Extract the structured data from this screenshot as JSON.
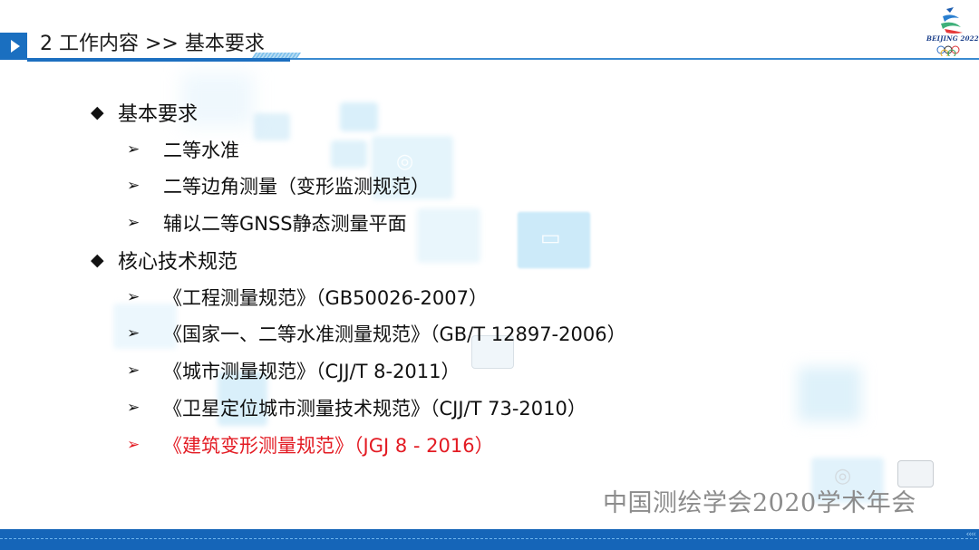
{
  "header": {
    "title": "2 工作内容 >> 基本要求",
    "play_icon": "play-triangle-icon",
    "accent_color": "#1a6fc0"
  },
  "logo": {
    "text": "BEIJING 2022",
    "icon": "olympic-rings-icon"
  },
  "sections": [
    {
      "bullet": "◆",
      "label": "基本要求",
      "items": [
        {
          "bullet": "➢",
          "label": "二等水准"
        },
        {
          "bullet": "➢",
          "label": "二等边角测量（变形监测规范）"
        },
        {
          "bullet": "➢",
          "label": "辅以二等GNSS静态测量平面"
        }
      ]
    },
    {
      "bullet": "◆",
      "label": "核心技术规范",
      "items": [
        {
          "bullet": "➢",
          "label": "《工程测量规范》（GB50026-2007）"
        },
        {
          "bullet": "➢",
          "label": "《国家一、二等水准测量规范》（GB/T 12897-2006）"
        },
        {
          "bullet": "➢",
          "label": "《城市测量规范》（CJJ/T 8-2011）"
        },
        {
          "bullet": "➢",
          "label": "《卫星定位城市测量技术规范》（CJJ/T 73-2010）"
        },
        {
          "bullet": "➢",
          "label": "《建筑变形测量规范》（JGJ 8 - 2016）",
          "highlight": true,
          "color": "#e31b23"
        }
      ]
    }
  ],
  "footer": {
    "text": "中国测绘学会2020学术年会",
    "chevrons": "‹‹‹‹",
    "bar_color": "#1565b8"
  }
}
